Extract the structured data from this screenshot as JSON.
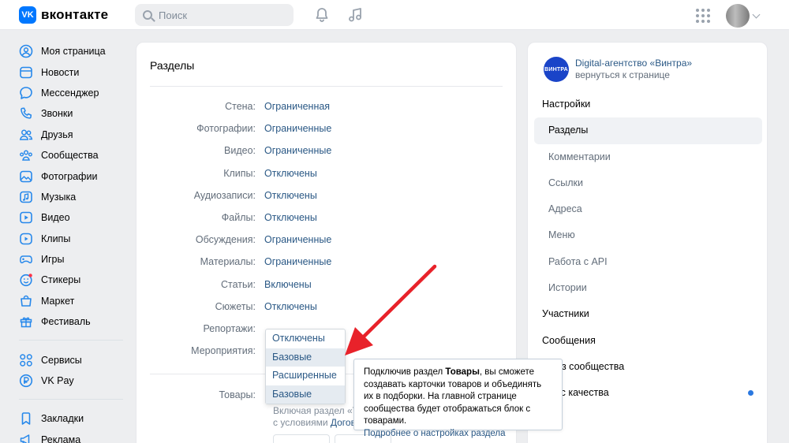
{
  "header": {
    "logo_text": "вконтакте",
    "logo_mark": "VK",
    "search_placeholder": "Поиск",
    "icons": [
      "bell-icon",
      "music-icon",
      "apps-grid-icon"
    ]
  },
  "leftnav": {
    "items": [
      {
        "label": "Моя страница",
        "icon": "user-circle-icon"
      },
      {
        "label": "Новости",
        "icon": "news-icon"
      },
      {
        "label": "Мессенджер",
        "icon": "message-icon"
      },
      {
        "label": "Звонки",
        "icon": "phone-icon"
      },
      {
        "label": "Друзья",
        "icon": "friends-icon"
      },
      {
        "label": "Сообщества",
        "icon": "communities-icon"
      },
      {
        "label": "Фотографии",
        "icon": "photo-icon"
      },
      {
        "label": "Музыка",
        "icon": "music-icon"
      },
      {
        "label": "Видео",
        "icon": "video-icon"
      },
      {
        "label": "Клипы",
        "icon": "clips-icon"
      },
      {
        "label": "Игры",
        "icon": "gamepad-icon"
      },
      {
        "label": "Стикеры",
        "icon": "sticker-icon"
      },
      {
        "label": "Маркет",
        "icon": "market-icon"
      },
      {
        "label": "Фестиваль",
        "icon": "gift-icon"
      }
    ],
    "items2": [
      {
        "label": "Сервисы",
        "icon": "services-icon"
      },
      {
        "label": "VK Pay",
        "icon": "vkpay-icon"
      }
    ],
    "items3": [
      {
        "label": "Закладки",
        "icon": "bookmark-icon"
      },
      {
        "label": "Реклама",
        "icon": "megaphone-icon"
      }
    ]
  },
  "sections": {
    "title": "Разделы",
    "rows": [
      {
        "label": "Стена:",
        "value": "Ограниченная"
      },
      {
        "label": "Фотографии:",
        "value": "Ограниченные"
      },
      {
        "label": "Видео:",
        "value": "Ограниченные"
      },
      {
        "label": "Клипы:",
        "value": "Отключены"
      },
      {
        "label": "Аудиозаписи:",
        "value": "Отключены"
      },
      {
        "label": "Файлы:",
        "value": "Отключены"
      },
      {
        "label": "Обсуждения:",
        "value": "Ограниченные"
      },
      {
        "label": "Материалы:",
        "value": "Ограниченные"
      },
      {
        "label": "Статьи:",
        "value": "Включены"
      },
      {
        "label": "Сюжеты:",
        "value": "Отключены"
      },
      {
        "label": "Репортажи:",
        "value": ""
      },
      {
        "label": "Мероприятия:",
        "value": ""
      }
    ],
    "goods_label": "Товары:",
    "goods_hint_line1": "Включая раздел «То",
    "goods_hint_line2_prefix": "с условиями ",
    "goods_hint_link": "Догово"
  },
  "dropdown": {
    "options": [
      "Отключены",
      "Базовые",
      "Расширенные",
      "Базовые"
    ]
  },
  "tooltip": {
    "text_before": "Подключив раздел ",
    "bold": "Товары",
    "text_after": ", вы сможете создавать карточки товаров и объединять их в подборки. На главной странице сообщества будет отображаться блок с товарами.",
    "link": "Подробнее о настройках раздела"
  },
  "annotation": {
    "arrow_color": "#e8222a"
  },
  "rightmenu": {
    "community_name": "Digital-агентство «Винтра»",
    "community_avatar_text": "ВИНТРА",
    "back_link": "вернуться к странице",
    "items": [
      {
        "label": "Настройки",
        "kind": "head"
      },
      {
        "label": "Разделы",
        "kind": "sub",
        "active": true
      },
      {
        "label": "Комментарии",
        "kind": "sub"
      },
      {
        "label": "Ссылки",
        "kind": "sub"
      },
      {
        "label": "Адреса",
        "kind": "sub"
      },
      {
        "label": "Меню",
        "kind": "sub"
      },
      {
        "label": "Работа с API",
        "kind": "sub"
      },
      {
        "label": "Истории",
        "kind": "sub"
      },
      {
        "label": "Участники",
        "kind": "head"
      },
      {
        "label": "Сообщения",
        "kind": "head"
      },
      {
        "label": "из сообщества",
        "kind": "head"
      },
      {
        "label": "кс качества",
        "kind": "head",
        "dot": true
      }
    ]
  },
  "colors": {
    "accent": "#2688eb",
    "link": "#2a5885",
    "background": "#edeef0",
    "arrow": "#e8222a"
  }
}
